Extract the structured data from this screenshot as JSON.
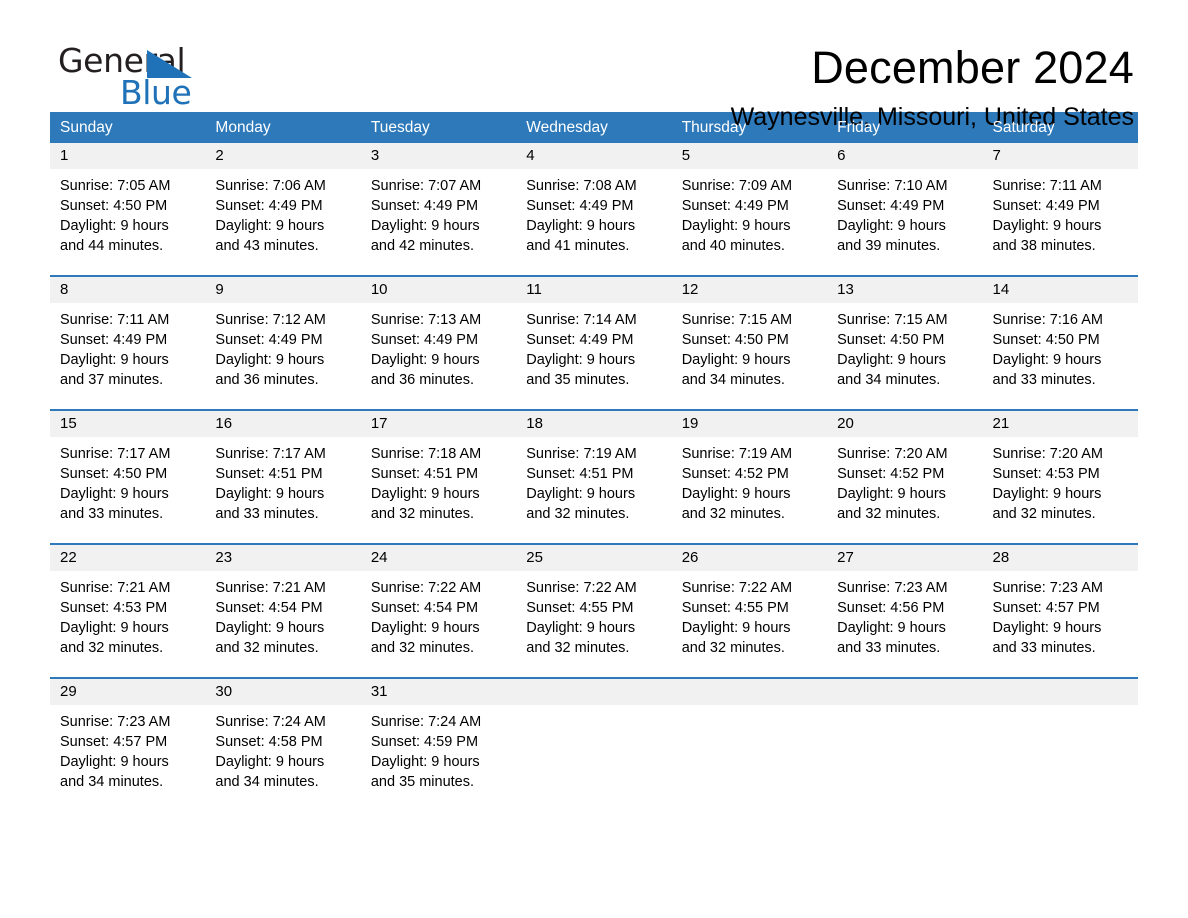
{
  "brand": {
    "name_part1": "General",
    "name_part2": "Blue",
    "flag_icon": "triangle-flag-icon",
    "flag_color": "#1f72b8"
  },
  "header": {
    "month_title": "December 2024",
    "location": "Waynesville, Missouri, United States"
  },
  "theme": {
    "header_blue": "#2e79ba",
    "daynum_band": "#f1f1f1",
    "text": "#000000"
  },
  "weekdays": [
    "Sunday",
    "Monday",
    "Tuesday",
    "Wednesday",
    "Thursday",
    "Friday",
    "Saturday"
  ],
  "weeks": [
    [
      {
        "day": "1",
        "sunrise": "Sunrise: 7:05 AM",
        "sunset": "Sunset: 4:50 PM",
        "daylight1": "Daylight: 9 hours",
        "daylight2": "and 44 minutes."
      },
      {
        "day": "2",
        "sunrise": "Sunrise: 7:06 AM",
        "sunset": "Sunset: 4:49 PM",
        "daylight1": "Daylight: 9 hours",
        "daylight2": "and 43 minutes."
      },
      {
        "day": "3",
        "sunrise": "Sunrise: 7:07 AM",
        "sunset": "Sunset: 4:49 PM",
        "daylight1": "Daylight: 9 hours",
        "daylight2": "and 42 minutes."
      },
      {
        "day": "4",
        "sunrise": "Sunrise: 7:08 AM",
        "sunset": "Sunset: 4:49 PM",
        "daylight1": "Daylight: 9 hours",
        "daylight2": "and 41 minutes."
      },
      {
        "day": "5",
        "sunrise": "Sunrise: 7:09 AM",
        "sunset": "Sunset: 4:49 PM",
        "daylight1": "Daylight: 9 hours",
        "daylight2": "and 40 minutes."
      },
      {
        "day": "6",
        "sunrise": "Sunrise: 7:10 AM",
        "sunset": "Sunset: 4:49 PM",
        "daylight1": "Daylight: 9 hours",
        "daylight2": "and 39 minutes."
      },
      {
        "day": "7",
        "sunrise": "Sunrise: 7:11 AM",
        "sunset": "Sunset: 4:49 PM",
        "daylight1": "Daylight: 9 hours",
        "daylight2": "and 38 minutes."
      }
    ],
    [
      {
        "day": "8",
        "sunrise": "Sunrise: 7:11 AM",
        "sunset": "Sunset: 4:49 PM",
        "daylight1": "Daylight: 9 hours",
        "daylight2": "and 37 minutes."
      },
      {
        "day": "9",
        "sunrise": "Sunrise: 7:12 AM",
        "sunset": "Sunset: 4:49 PM",
        "daylight1": "Daylight: 9 hours",
        "daylight2": "and 36 minutes."
      },
      {
        "day": "10",
        "sunrise": "Sunrise: 7:13 AM",
        "sunset": "Sunset: 4:49 PM",
        "daylight1": "Daylight: 9 hours",
        "daylight2": "and 36 minutes."
      },
      {
        "day": "11",
        "sunrise": "Sunrise: 7:14 AM",
        "sunset": "Sunset: 4:49 PM",
        "daylight1": "Daylight: 9 hours",
        "daylight2": "and 35 minutes."
      },
      {
        "day": "12",
        "sunrise": "Sunrise: 7:15 AM",
        "sunset": "Sunset: 4:50 PM",
        "daylight1": "Daylight: 9 hours",
        "daylight2": "and 34 minutes."
      },
      {
        "day": "13",
        "sunrise": "Sunrise: 7:15 AM",
        "sunset": "Sunset: 4:50 PM",
        "daylight1": "Daylight: 9 hours",
        "daylight2": "and 34 minutes."
      },
      {
        "day": "14",
        "sunrise": "Sunrise: 7:16 AM",
        "sunset": "Sunset: 4:50 PM",
        "daylight1": "Daylight: 9 hours",
        "daylight2": "and 33 minutes."
      }
    ],
    [
      {
        "day": "15",
        "sunrise": "Sunrise: 7:17 AM",
        "sunset": "Sunset: 4:50 PM",
        "daylight1": "Daylight: 9 hours",
        "daylight2": "and 33 minutes."
      },
      {
        "day": "16",
        "sunrise": "Sunrise: 7:17 AM",
        "sunset": "Sunset: 4:51 PM",
        "daylight1": "Daylight: 9 hours",
        "daylight2": "and 33 minutes."
      },
      {
        "day": "17",
        "sunrise": "Sunrise: 7:18 AM",
        "sunset": "Sunset: 4:51 PM",
        "daylight1": "Daylight: 9 hours",
        "daylight2": "and 32 minutes."
      },
      {
        "day": "18",
        "sunrise": "Sunrise: 7:19 AM",
        "sunset": "Sunset: 4:51 PM",
        "daylight1": "Daylight: 9 hours",
        "daylight2": "and 32 minutes."
      },
      {
        "day": "19",
        "sunrise": "Sunrise: 7:19 AM",
        "sunset": "Sunset: 4:52 PM",
        "daylight1": "Daylight: 9 hours",
        "daylight2": "and 32 minutes."
      },
      {
        "day": "20",
        "sunrise": "Sunrise: 7:20 AM",
        "sunset": "Sunset: 4:52 PM",
        "daylight1": "Daylight: 9 hours",
        "daylight2": "and 32 minutes."
      },
      {
        "day": "21",
        "sunrise": "Sunrise: 7:20 AM",
        "sunset": "Sunset: 4:53 PM",
        "daylight1": "Daylight: 9 hours",
        "daylight2": "and 32 minutes."
      }
    ],
    [
      {
        "day": "22",
        "sunrise": "Sunrise: 7:21 AM",
        "sunset": "Sunset: 4:53 PM",
        "daylight1": "Daylight: 9 hours",
        "daylight2": "and 32 minutes."
      },
      {
        "day": "23",
        "sunrise": "Sunrise: 7:21 AM",
        "sunset": "Sunset: 4:54 PM",
        "daylight1": "Daylight: 9 hours",
        "daylight2": "and 32 minutes."
      },
      {
        "day": "24",
        "sunrise": "Sunrise: 7:22 AM",
        "sunset": "Sunset: 4:54 PM",
        "daylight1": "Daylight: 9 hours",
        "daylight2": "and 32 minutes."
      },
      {
        "day": "25",
        "sunrise": "Sunrise: 7:22 AM",
        "sunset": "Sunset: 4:55 PM",
        "daylight1": "Daylight: 9 hours",
        "daylight2": "and 32 minutes."
      },
      {
        "day": "26",
        "sunrise": "Sunrise: 7:22 AM",
        "sunset": "Sunset: 4:55 PM",
        "daylight1": "Daylight: 9 hours",
        "daylight2": "and 32 minutes."
      },
      {
        "day": "27",
        "sunrise": "Sunrise: 7:23 AM",
        "sunset": "Sunset: 4:56 PM",
        "daylight1": "Daylight: 9 hours",
        "daylight2": "and 33 minutes."
      },
      {
        "day": "28",
        "sunrise": "Sunrise: 7:23 AM",
        "sunset": "Sunset: 4:57 PM",
        "daylight1": "Daylight: 9 hours",
        "daylight2": "and 33 minutes."
      }
    ],
    [
      {
        "day": "29",
        "sunrise": "Sunrise: 7:23 AM",
        "sunset": "Sunset: 4:57 PM",
        "daylight1": "Daylight: 9 hours",
        "daylight2": "and 34 minutes."
      },
      {
        "day": "30",
        "sunrise": "Sunrise: 7:24 AM",
        "sunset": "Sunset: 4:58 PM",
        "daylight1": "Daylight: 9 hours",
        "daylight2": "and 34 minutes."
      },
      {
        "day": "31",
        "sunrise": "Sunrise: 7:24 AM",
        "sunset": "Sunset: 4:59 PM",
        "daylight1": "Daylight: 9 hours",
        "daylight2": "and 35 minutes."
      },
      {
        "day": "",
        "sunrise": "",
        "sunset": "",
        "daylight1": "",
        "daylight2": ""
      },
      {
        "day": "",
        "sunrise": "",
        "sunset": "",
        "daylight1": "",
        "daylight2": ""
      },
      {
        "day": "",
        "sunrise": "",
        "sunset": "",
        "daylight1": "",
        "daylight2": ""
      },
      {
        "day": "",
        "sunrise": "",
        "sunset": "",
        "daylight1": "",
        "daylight2": ""
      }
    ]
  ]
}
